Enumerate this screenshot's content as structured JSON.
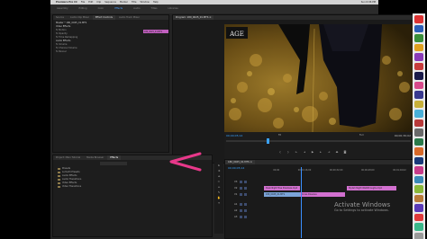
{
  "menubar": {
    "apple": "",
    "app": "Premiere Pro CC",
    "items": [
      "File",
      "Edit",
      "Clip",
      "Sequence",
      "Marker",
      "Title",
      "Window",
      "Help"
    ],
    "right": "Sun 6:06 PM"
  },
  "workspace_tabs": [
    "Assembly",
    "Editing",
    "Color",
    "Effects",
    "Audio",
    "Titles",
    "Libraries"
  ],
  "top_left_panel": {
    "tabs": [
      "Source",
      "Audio Clip Mixer",
      "Effect Controls",
      "Audio Track Mixer"
    ],
    "rows": [
      "Master * 180_0025_01.MTS",
      "Video Effects",
      "fx Motion",
      "fx Opacity",
      "fx Time Remapping",
      "Audio Effects",
      "fx Volume",
      "fx Channel Volume",
      "fx Panner"
    ],
    "clip_label": "180_0025_01.MTS"
  },
  "program": {
    "tab": "Program: 180_0025_01.MTS ≡",
    "logo": "AGE",
    "timecode_left": "00;00;05;14",
    "timecode_right": "00;00;30;02",
    "zoom": "Fit",
    "quality": "Full"
  },
  "project_panel": {
    "tabs": [
      "Project: Main Tutorial",
      "Media Browser",
      "Effects"
    ],
    "active_tab": "Effects",
    "items": [
      "Presets",
      "Lumetri Presets",
      "Audio Effects",
      "Audio Transitions",
      "Video Effects",
      "Video Transitions"
    ]
  },
  "timeline": {
    "tab": "180_0025_01.MTS ≡",
    "timecode": "00;00;05;14",
    "ruler": [
      "00;00",
      "00;00;16;00",
      "00;00;32;00",
      "00;00;48;00",
      "00;01;04;02"
    ],
    "video_tracks": [
      "V3",
      "V2",
      "V1"
    ],
    "audio_tracks": [
      "A1",
      "A2",
      "A3"
    ],
    "clips": [
      {
        "label": "Dusk Night Tree Shadows.mp4",
        "track": "V2",
        "color": "pink"
      },
      {
        "label": "Stylish Night Walkthroughs.mp4",
        "track": "V2",
        "color": "pink"
      },
      {
        "label": "180_0025_01.MTS",
        "track": "V1",
        "color": "blue"
      },
      {
        "label": "Cross Dissolve",
        "track": "V1",
        "color": "pink"
      }
    ]
  },
  "watermark": {
    "line1": "Activate Windows",
    "line2": "Go to Settings to activate Windows."
  },
  "colors": {
    "accent_pink": "#e8388a",
    "timecode_blue": "#3aa3ff",
    "clip_pink": "#d270d0",
    "clip_blue": "#7ba4d9"
  }
}
